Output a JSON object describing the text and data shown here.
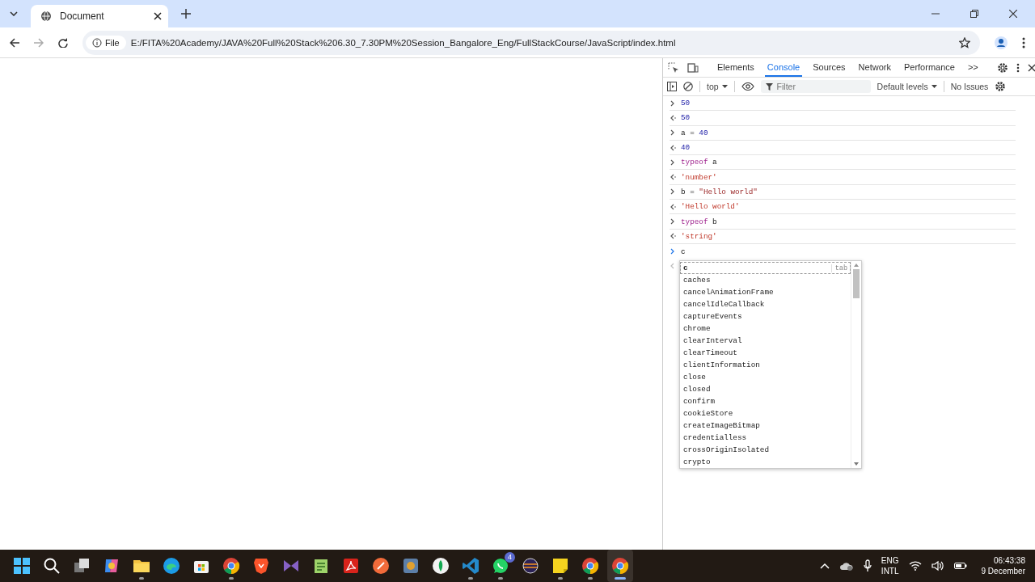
{
  "browser": {
    "tab": {
      "title": "Document"
    },
    "address": {
      "scheme_label": "File",
      "url": "E:/FITA%20Academy/JAVA%20Full%20Stack%206.30_7.30PM%20Session_Bangalore_Eng/FullStackCourse/JavaScript/index.html"
    }
  },
  "devtools": {
    "tabs": [
      {
        "label": "Elements",
        "selected": false
      },
      {
        "label": "Console",
        "selected": true
      },
      {
        "label": "Sources",
        "selected": false
      },
      {
        "label": "Network",
        "selected": false
      },
      {
        "label": "Performance",
        "selected": false
      }
    ],
    "more_tabs": ">>",
    "toolbar": {
      "context": "top",
      "filter": {
        "placeholder": "Filter"
      },
      "levels": "Default levels",
      "issues": "No Issues"
    },
    "console": [
      {
        "kind": "input",
        "parts": [
          {
            "text": "50",
            "kind": "number"
          }
        ]
      },
      {
        "kind": "output",
        "parts": [
          {
            "text": "50",
            "kind": "number"
          }
        ]
      },
      {
        "kind": "input",
        "parts": [
          {
            "text": "a",
            "kind": "plain"
          },
          {
            "text": " = ",
            "kind": "plain"
          },
          {
            "text": "40",
            "kind": "number"
          }
        ]
      },
      {
        "kind": "output",
        "parts": [
          {
            "text": "40",
            "kind": "number"
          }
        ]
      },
      {
        "kind": "input",
        "parts": [
          {
            "text": "typeof",
            "kind": "keyword"
          },
          {
            "text": " a",
            "kind": "plain"
          }
        ]
      },
      {
        "kind": "output",
        "parts": [
          {
            "text": "'number'",
            "kind": "string"
          }
        ]
      },
      {
        "kind": "input",
        "parts": [
          {
            "text": "b = ",
            "kind": "plain"
          },
          {
            "text": "\"Hello world\"",
            "kind": "literal"
          }
        ]
      },
      {
        "kind": "output",
        "parts": [
          {
            "text": "'Hello world'",
            "kind": "string"
          }
        ]
      },
      {
        "kind": "input",
        "parts": [
          {
            "text": "typeof",
            "kind": "keyword"
          },
          {
            "text": " b",
            "kind": "plain"
          }
        ]
      },
      {
        "kind": "output",
        "parts": [
          {
            "text": "'string'",
            "kind": "string"
          }
        ]
      }
    ],
    "prompt": {
      "value": "c"
    },
    "autocomplete": {
      "hint": "tab",
      "items": [
        {
          "label": "c",
          "selected": true
        },
        {
          "label": "caches",
          "selected": false
        },
        {
          "label": "cancelAnimationFrame",
          "selected": false
        },
        {
          "label": "cancelIdleCallback",
          "selected": false
        },
        {
          "label": "captureEvents",
          "selected": false
        },
        {
          "label": "chrome",
          "selected": false
        },
        {
          "label": "clearInterval",
          "selected": false
        },
        {
          "label": "clearTimeout",
          "selected": false
        },
        {
          "label": "clientInformation",
          "selected": false
        },
        {
          "label": "close",
          "selected": false
        },
        {
          "label": "closed",
          "selected": false
        },
        {
          "label": "confirm",
          "selected": false
        },
        {
          "label": "cookieStore",
          "selected": false
        },
        {
          "label": "createImageBitmap",
          "selected": false
        },
        {
          "label": "credentialless",
          "selected": false
        },
        {
          "label": "crossOriginIsolated",
          "selected": false
        },
        {
          "label": "crypto",
          "selected": false
        }
      ]
    }
  },
  "taskbar": {
    "apps": [
      {
        "kind": "windows",
        "running": false,
        "selected": false
      },
      {
        "kind": "search",
        "running": false,
        "selected": false
      },
      {
        "kind": "taskview",
        "running": false,
        "selected": false
      },
      {
        "kind": "copilot",
        "running": false,
        "selected": false
      },
      {
        "kind": "folder",
        "running": true,
        "selected": false
      },
      {
        "kind": "edge",
        "running": false,
        "selected": false
      },
      {
        "kind": "store",
        "running": false,
        "selected": false
      },
      {
        "kind": "chrome",
        "running": true,
        "selected": false
      },
      {
        "kind": "brave",
        "running": false,
        "selected": false
      },
      {
        "kind": "studio",
        "running": false,
        "selected": false
      },
      {
        "kind": "notepad",
        "running": false,
        "selected": false
      },
      {
        "kind": "pdf",
        "running": false,
        "selected": false
      },
      {
        "kind": "postman",
        "running": false,
        "selected": false
      },
      {
        "kind": "media",
        "running": false,
        "selected": false
      },
      {
        "kind": "mongo",
        "running": false,
        "selected": false
      },
      {
        "kind": "vscode",
        "running": true,
        "selected": false
      },
      {
        "kind": "whatsapp",
        "running": true,
        "selected": false,
        "badge": "4"
      },
      {
        "kind": "eclipse",
        "running": false,
        "selected": false
      },
      {
        "kind": "notes",
        "running": true,
        "selected": false
      },
      {
        "kind": "chrome",
        "running": true,
        "selected": false
      },
      {
        "kind": "chrome",
        "running": true,
        "selected": true
      }
    ],
    "language": [
      "ENG",
      "INTL"
    ],
    "time": "06:43:38",
    "date": "9 December"
  }
}
